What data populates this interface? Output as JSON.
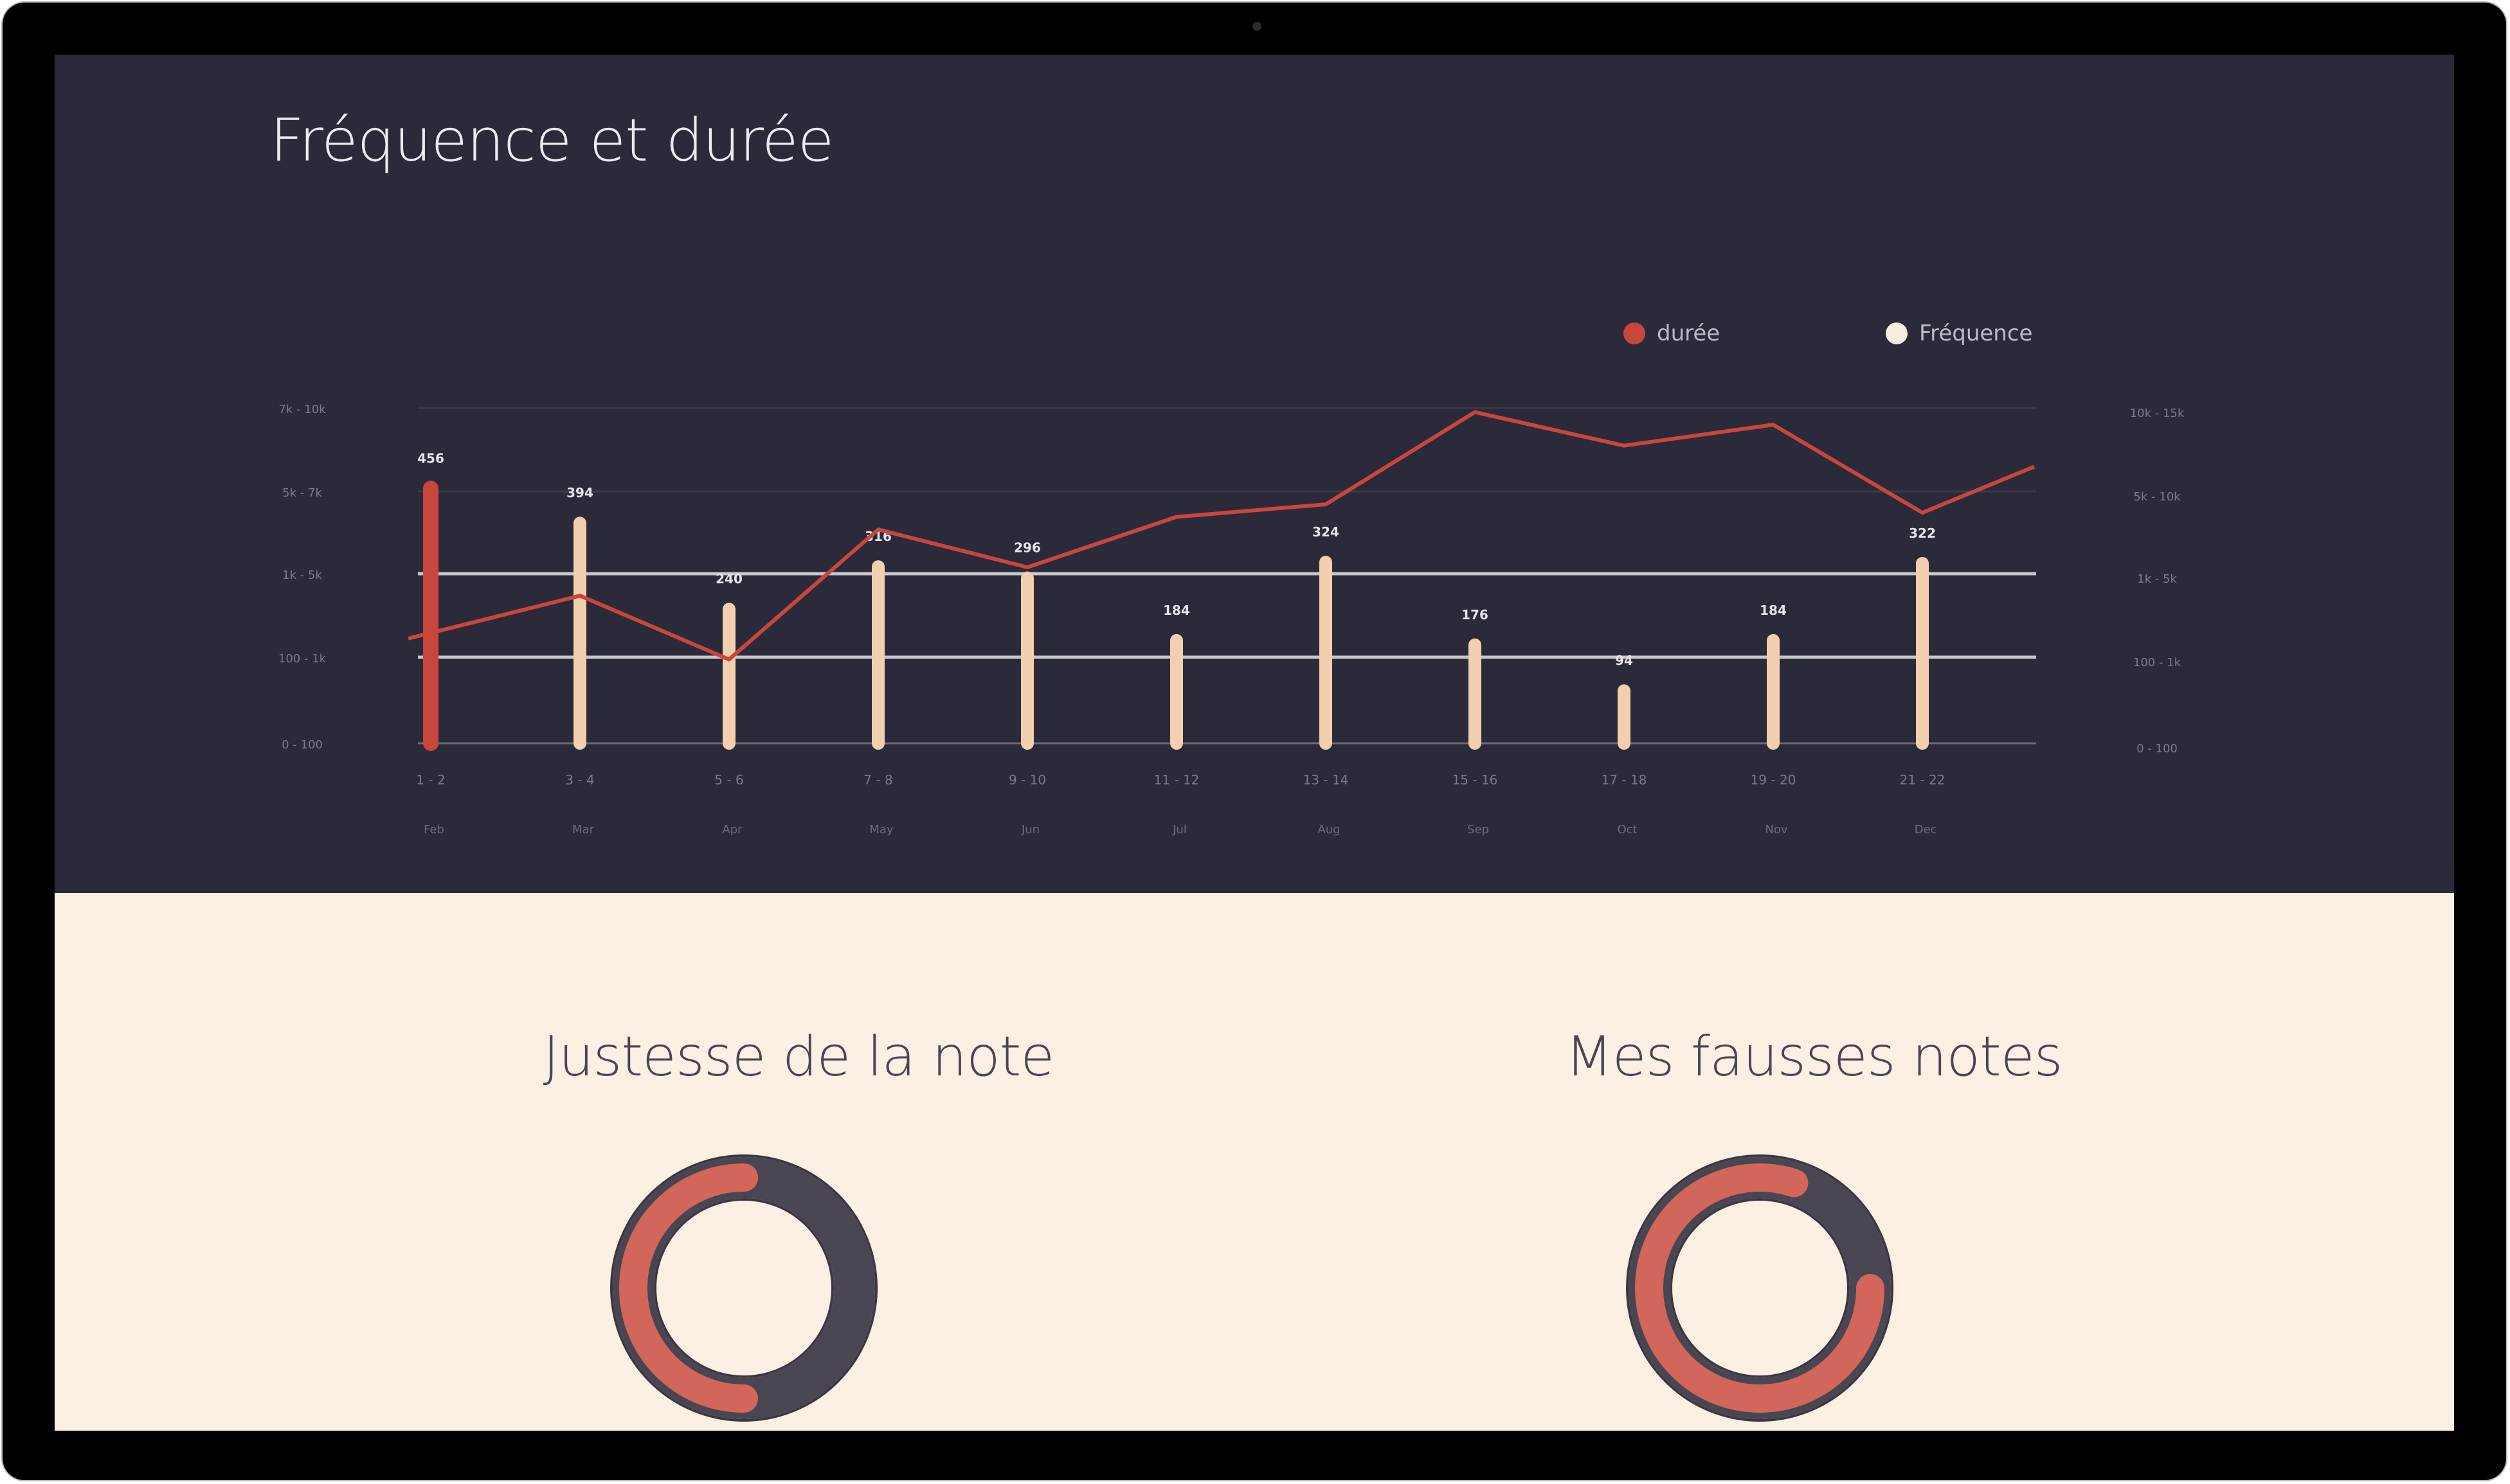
{
  "page": {
    "title": "Fréquence et durée"
  },
  "legend": {
    "duree_label": "durée",
    "frequence_label": "Fréquence"
  },
  "colors": {
    "top_background": "#2b2a3a",
    "bottom_background": "#fcf0e4",
    "duree": "#c8463c",
    "frequence": "#f2cfae",
    "donut_track": "#4a4552",
    "donut_fill": "#d2665a"
  },
  "chart_data": {
    "type": "bar",
    "title": "Fréquence et durée",
    "categories": [
      "1 - 2",
      "3 - 4",
      "5 - 6",
      "7 - 8",
      "9 - 10",
      "11 - 12",
      "13 - 14",
      "15 - 16",
      "17 - 18",
      "19 - 20",
      "21 - 22"
    ],
    "month_labels": [
      "Feb",
      "Mar",
      "Apr",
      "May",
      "Jun",
      "Jul",
      "Aug",
      "Sep",
      "Oct",
      "Nov",
      "Dec"
    ],
    "left_axis_labels": [
      "0 - 100",
      "100 - 1k",
      "1k - 5k",
      "5k - 7k",
      "7k - 10k"
    ],
    "right_axis_labels": [
      "0 - 100",
      "100 - 1k",
      "1k - 5k",
      "5k - 10k",
      "10k - 15k"
    ],
    "grid": true,
    "legend_position": "top-right",
    "series": [
      {
        "name": "Fréquence",
        "type": "bar",
        "values": [
          456,
          394,
          240,
          316,
          296,
          184,
          324,
          176,
          94,
          184,
          322
        ],
        "value_labels": [
          "456",
          "394",
          "240",
          "316",
          "296",
          "184",
          "324",
          "176",
          "94",
          "184",
          "322"
        ]
      },
      {
        "name": "durée",
        "type": "line",
        "x": [
          0,
          1,
          2,
          3,
          4,
          5,
          6,
          7,
          8,
          9,
          10,
          10.75
        ],
        "values": [
          1.25,
          1.76,
          1.0,
          2.55,
          2.1,
          2.7,
          2.85,
          3.95,
          3.55,
          3.8,
          2.75,
          3.3
        ]
      }
    ],
    "highlight_index": 0,
    "bar_ylim": [
      0,
      600
    ],
    "line_ylim": [
      0,
      4
    ]
  },
  "donuts": [
    {
      "title": "Justesse de la note",
      "value": 0.5,
      "start_angle_deg": 90
    },
    {
      "title": "Mes fausses notes",
      "value": 0.8,
      "start_angle_deg": 0
    }
  ]
}
